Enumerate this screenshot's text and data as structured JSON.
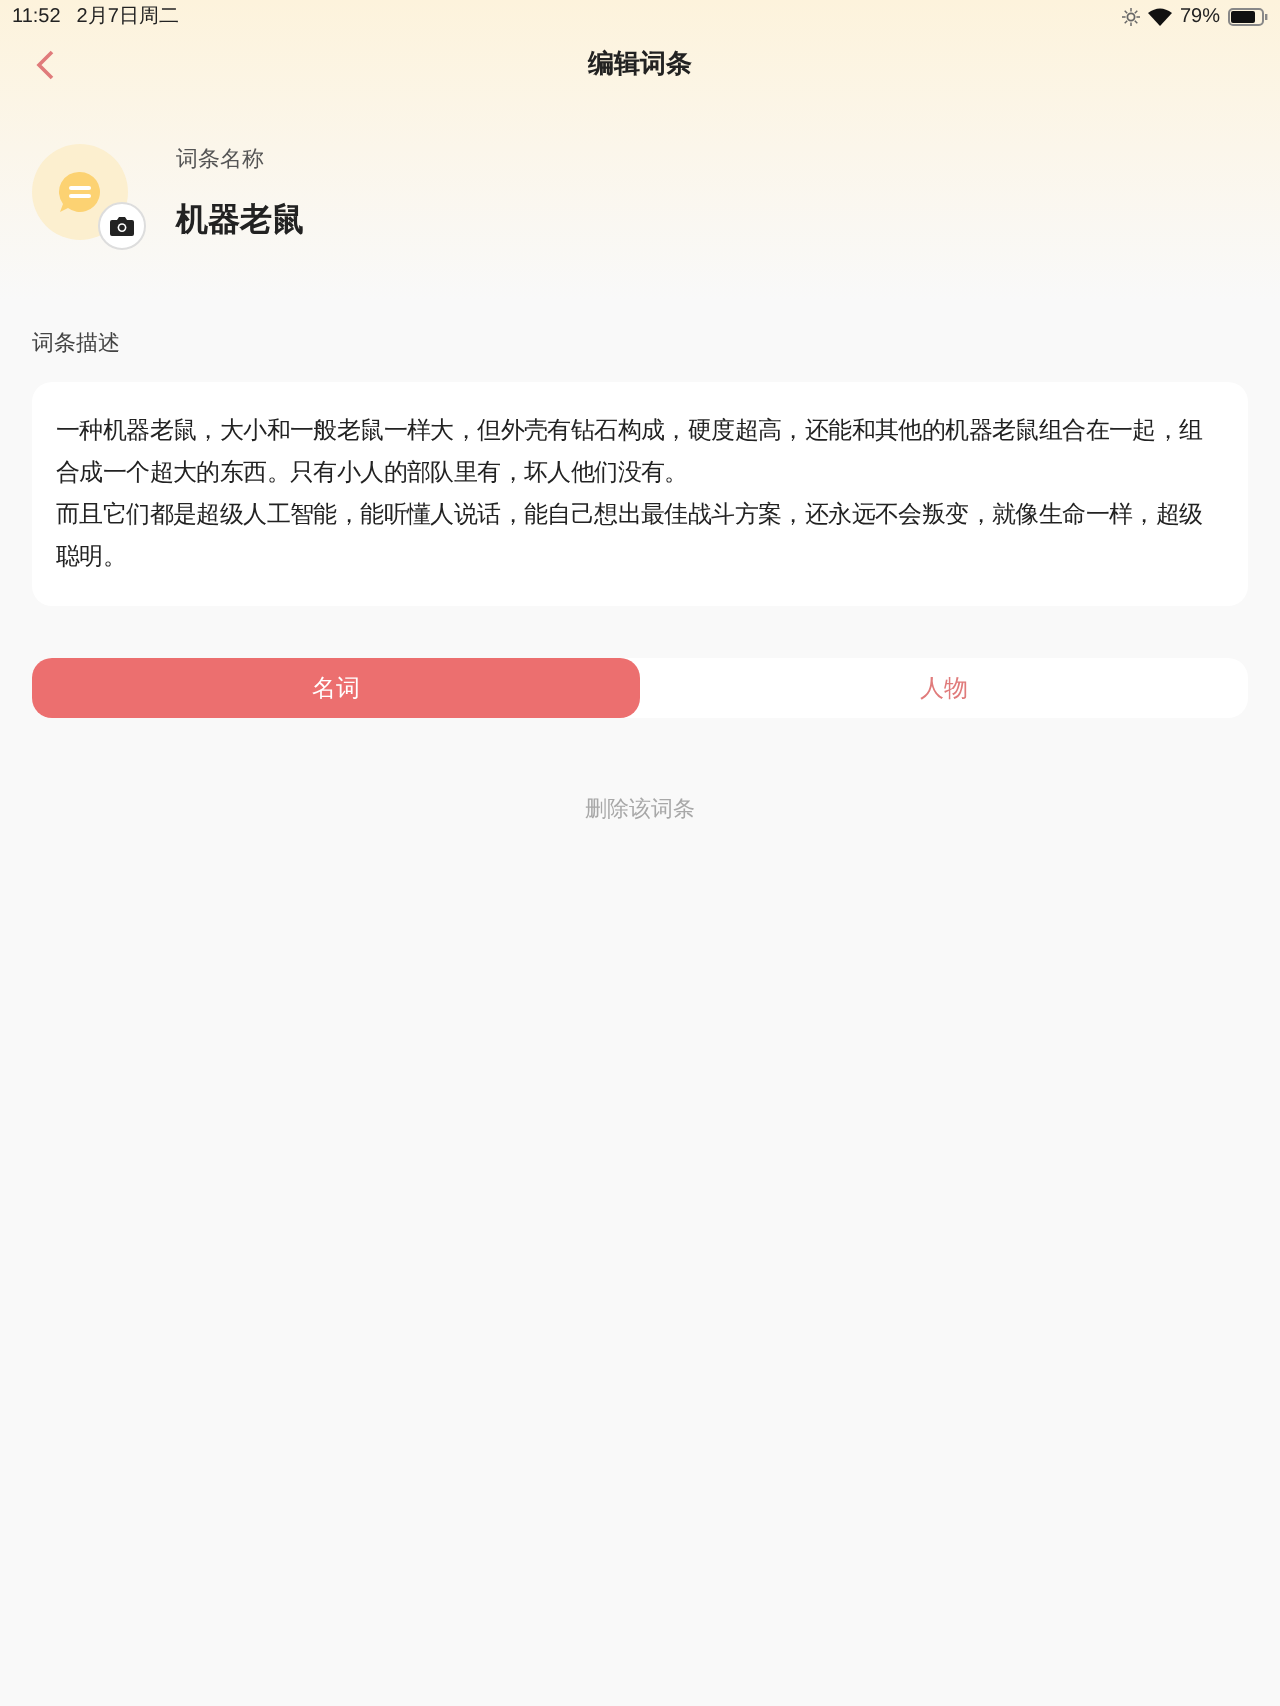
{
  "status_bar": {
    "time": "11:52",
    "date": "2月7日周二",
    "battery": "79%"
  },
  "nav": {
    "title": "编辑词条"
  },
  "entry": {
    "name_label": "词条名称",
    "name": "机器老鼠"
  },
  "description": {
    "label": "词条描述",
    "paragraphs": [
      "一种机器老鼠，大小和一般老鼠一样大，但外壳有钻石构成，硬度超高，还能和其他的机器老鼠组合在一起，组合成一个超大的东西。只有小人的部队里有，坏人他们没有。",
      "而且它们都是超级人工智能，能听懂人说话，能自己想出最佳战斗方案，还永远不会叛变，就像生命一样，超级聪明。"
    ]
  },
  "type_tabs": [
    {
      "label": "名词",
      "selected": true
    },
    {
      "label": "人物",
      "selected": false
    }
  ],
  "delete_button": "删除该词条"
}
